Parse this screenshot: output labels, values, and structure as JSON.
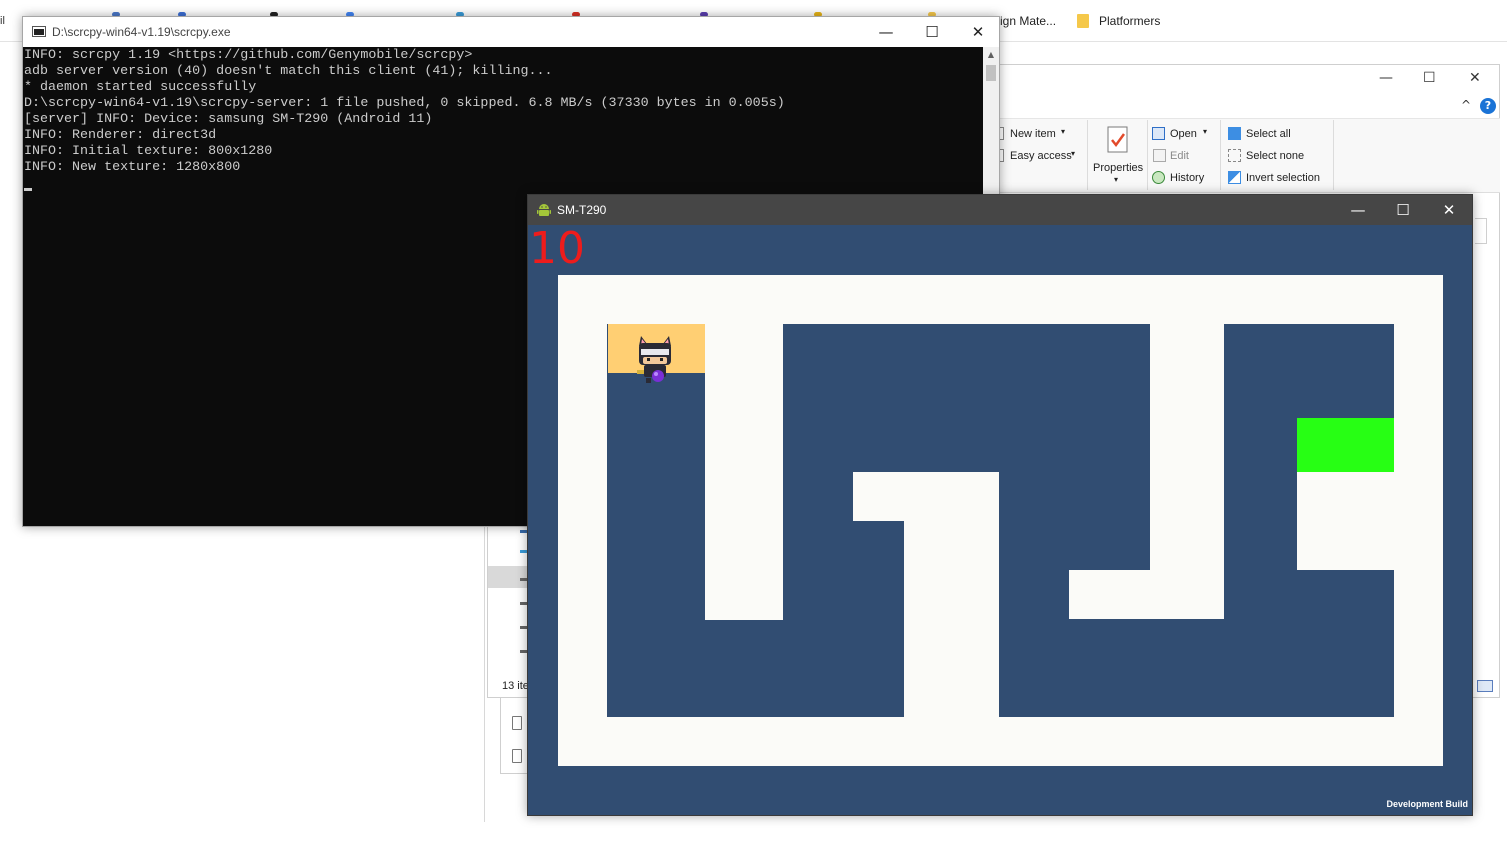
{
  "browser": {
    "left_fragment": "il",
    "bookmark_design": "ign Mate...",
    "bookmark_platformers": "Platformers"
  },
  "console_window": {
    "title": "D:\\scrcpy-win64-v1.19\\scrcpy.exe",
    "controls": {
      "minimize": "—",
      "maximize": "☐",
      "close": "✕"
    },
    "lines": [
      "INFO: scrcpy 1.19 <https://github.com/Genymobile/scrcpy>",
      "adb server version (40) doesn't match this client (41); killing...",
      "* daemon started successfully",
      "D:\\scrcpy-win64-v1.19\\scrcpy-server: 1 file pushed, 0 skipped. 6.8 MB/s (37330 bytes in 0.005s)",
      "[server] INFO: Device: samsung SM-T290 (Android 11)",
      "INFO: Renderer: direct3d",
      "INFO: Initial texture: 800x1280",
      "INFO: New texture: 1280x800"
    ]
  },
  "explorer": {
    "controls": {
      "minimize": "—",
      "maximize": "☐",
      "close": "✕",
      "collapse": "^",
      "help": "?"
    },
    "ribbon": {
      "new_item": "New item",
      "easy_access": "Easy access",
      "properties": "Properties",
      "open": "Open",
      "edit": "Edit",
      "history": "History",
      "select_all": "Select all",
      "select_none": "Select none",
      "invert_selection": "Invert selection"
    },
    "status": "13 ite"
  },
  "device_window": {
    "title": "SM-T290",
    "controls": {
      "minimize": "—",
      "maximize": "☐",
      "close": "✕"
    },
    "score": "10",
    "build_label": "Development Build"
  },
  "colors": {
    "game_bg": "#314d72",
    "path": "#fbfbf8",
    "start": "#ffcf73",
    "goal": "#27ff14",
    "score": "#ee1c1c",
    "console_bg": "#0c0c0c",
    "console_text": "#cccccc"
  },
  "icons": {
    "console": "console-app-icon",
    "device": "android-icon",
    "player": "cat-character-icon"
  }
}
